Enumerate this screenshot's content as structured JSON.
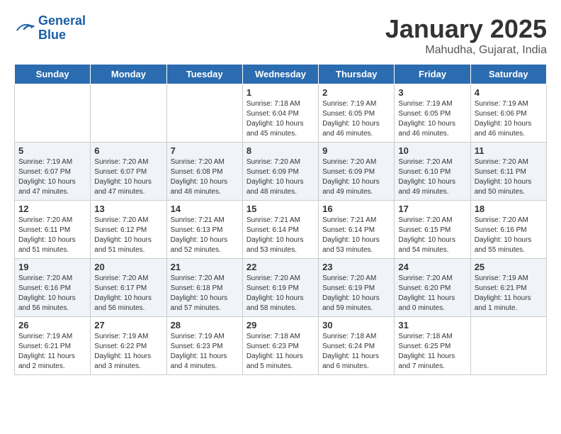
{
  "header": {
    "logo_line1": "General",
    "logo_line2": "Blue",
    "title": "January 2025",
    "subtitle": "Mahudha, Gujarat, India"
  },
  "days_of_week": [
    "Sunday",
    "Monday",
    "Tuesday",
    "Wednesday",
    "Thursday",
    "Friday",
    "Saturday"
  ],
  "weeks": [
    [
      {
        "day": "",
        "info": ""
      },
      {
        "day": "",
        "info": ""
      },
      {
        "day": "",
        "info": ""
      },
      {
        "day": "1",
        "info": "Sunrise: 7:18 AM\nSunset: 6:04 PM\nDaylight: 10 hours\nand 45 minutes."
      },
      {
        "day": "2",
        "info": "Sunrise: 7:19 AM\nSunset: 6:05 PM\nDaylight: 10 hours\nand 46 minutes."
      },
      {
        "day": "3",
        "info": "Sunrise: 7:19 AM\nSunset: 6:05 PM\nDaylight: 10 hours\nand 46 minutes."
      },
      {
        "day": "4",
        "info": "Sunrise: 7:19 AM\nSunset: 6:06 PM\nDaylight: 10 hours\nand 46 minutes."
      }
    ],
    [
      {
        "day": "5",
        "info": "Sunrise: 7:19 AM\nSunset: 6:07 PM\nDaylight: 10 hours\nand 47 minutes."
      },
      {
        "day": "6",
        "info": "Sunrise: 7:20 AM\nSunset: 6:07 PM\nDaylight: 10 hours\nand 47 minutes."
      },
      {
        "day": "7",
        "info": "Sunrise: 7:20 AM\nSunset: 6:08 PM\nDaylight: 10 hours\nand 48 minutes."
      },
      {
        "day": "8",
        "info": "Sunrise: 7:20 AM\nSunset: 6:09 PM\nDaylight: 10 hours\nand 48 minutes."
      },
      {
        "day": "9",
        "info": "Sunrise: 7:20 AM\nSunset: 6:09 PM\nDaylight: 10 hours\nand 49 minutes."
      },
      {
        "day": "10",
        "info": "Sunrise: 7:20 AM\nSunset: 6:10 PM\nDaylight: 10 hours\nand 49 minutes."
      },
      {
        "day": "11",
        "info": "Sunrise: 7:20 AM\nSunset: 6:11 PM\nDaylight: 10 hours\nand 50 minutes."
      }
    ],
    [
      {
        "day": "12",
        "info": "Sunrise: 7:20 AM\nSunset: 6:11 PM\nDaylight: 10 hours\nand 51 minutes."
      },
      {
        "day": "13",
        "info": "Sunrise: 7:20 AM\nSunset: 6:12 PM\nDaylight: 10 hours\nand 51 minutes."
      },
      {
        "day": "14",
        "info": "Sunrise: 7:21 AM\nSunset: 6:13 PM\nDaylight: 10 hours\nand 52 minutes."
      },
      {
        "day": "15",
        "info": "Sunrise: 7:21 AM\nSunset: 6:14 PM\nDaylight: 10 hours\nand 53 minutes."
      },
      {
        "day": "16",
        "info": "Sunrise: 7:21 AM\nSunset: 6:14 PM\nDaylight: 10 hours\nand 53 minutes."
      },
      {
        "day": "17",
        "info": "Sunrise: 7:20 AM\nSunset: 6:15 PM\nDaylight: 10 hours\nand 54 minutes."
      },
      {
        "day": "18",
        "info": "Sunrise: 7:20 AM\nSunset: 6:16 PM\nDaylight: 10 hours\nand 55 minutes."
      }
    ],
    [
      {
        "day": "19",
        "info": "Sunrise: 7:20 AM\nSunset: 6:16 PM\nDaylight: 10 hours\nand 56 minutes."
      },
      {
        "day": "20",
        "info": "Sunrise: 7:20 AM\nSunset: 6:17 PM\nDaylight: 10 hours\nand 56 minutes."
      },
      {
        "day": "21",
        "info": "Sunrise: 7:20 AM\nSunset: 6:18 PM\nDaylight: 10 hours\nand 57 minutes."
      },
      {
        "day": "22",
        "info": "Sunrise: 7:20 AM\nSunset: 6:19 PM\nDaylight: 10 hours\nand 58 minutes."
      },
      {
        "day": "23",
        "info": "Sunrise: 7:20 AM\nSunset: 6:19 PM\nDaylight: 10 hours\nand 59 minutes."
      },
      {
        "day": "24",
        "info": "Sunrise: 7:20 AM\nSunset: 6:20 PM\nDaylight: 11 hours\nand 0 minutes."
      },
      {
        "day": "25",
        "info": "Sunrise: 7:19 AM\nSunset: 6:21 PM\nDaylight: 11 hours\nand 1 minute."
      }
    ],
    [
      {
        "day": "26",
        "info": "Sunrise: 7:19 AM\nSunset: 6:21 PM\nDaylight: 11 hours\nand 2 minutes."
      },
      {
        "day": "27",
        "info": "Sunrise: 7:19 AM\nSunset: 6:22 PM\nDaylight: 11 hours\nand 3 minutes."
      },
      {
        "day": "28",
        "info": "Sunrise: 7:19 AM\nSunset: 6:23 PM\nDaylight: 11 hours\nand 4 minutes."
      },
      {
        "day": "29",
        "info": "Sunrise: 7:18 AM\nSunset: 6:23 PM\nDaylight: 11 hours\nand 5 minutes."
      },
      {
        "day": "30",
        "info": "Sunrise: 7:18 AM\nSunset: 6:24 PM\nDaylight: 11 hours\nand 6 minutes."
      },
      {
        "day": "31",
        "info": "Sunrise: 7:18 AM\nSunset: 6:25 PM\nDaylight: 11 hours\nand 7 minutes."
      },
      {
        "day": "",
        "info": ""
      }
    ]
  ]
}
